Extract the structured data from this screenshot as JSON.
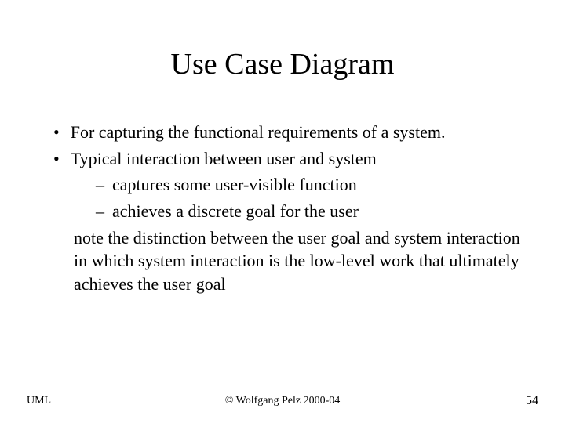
{
  "title": "Use Case Diagram",
  "bullets": {
    "b1": "For capturing the functional requirements of a system.",
    "b2": "Typical interaction between user and system",
    "b2_sub1": "captures some user-visible function",
    "b2_sub2": "achieves a discrete goal for the user",
    "note": "note the distinction between the user goal and system interaction in which system interaction is the low-level work that ultimately achieves the user goal"
  },
  "footer": {
    "left": "UML",
    "center": "© Wolfgang Pelz 2000-04",
    "right": "54"
  }
}
